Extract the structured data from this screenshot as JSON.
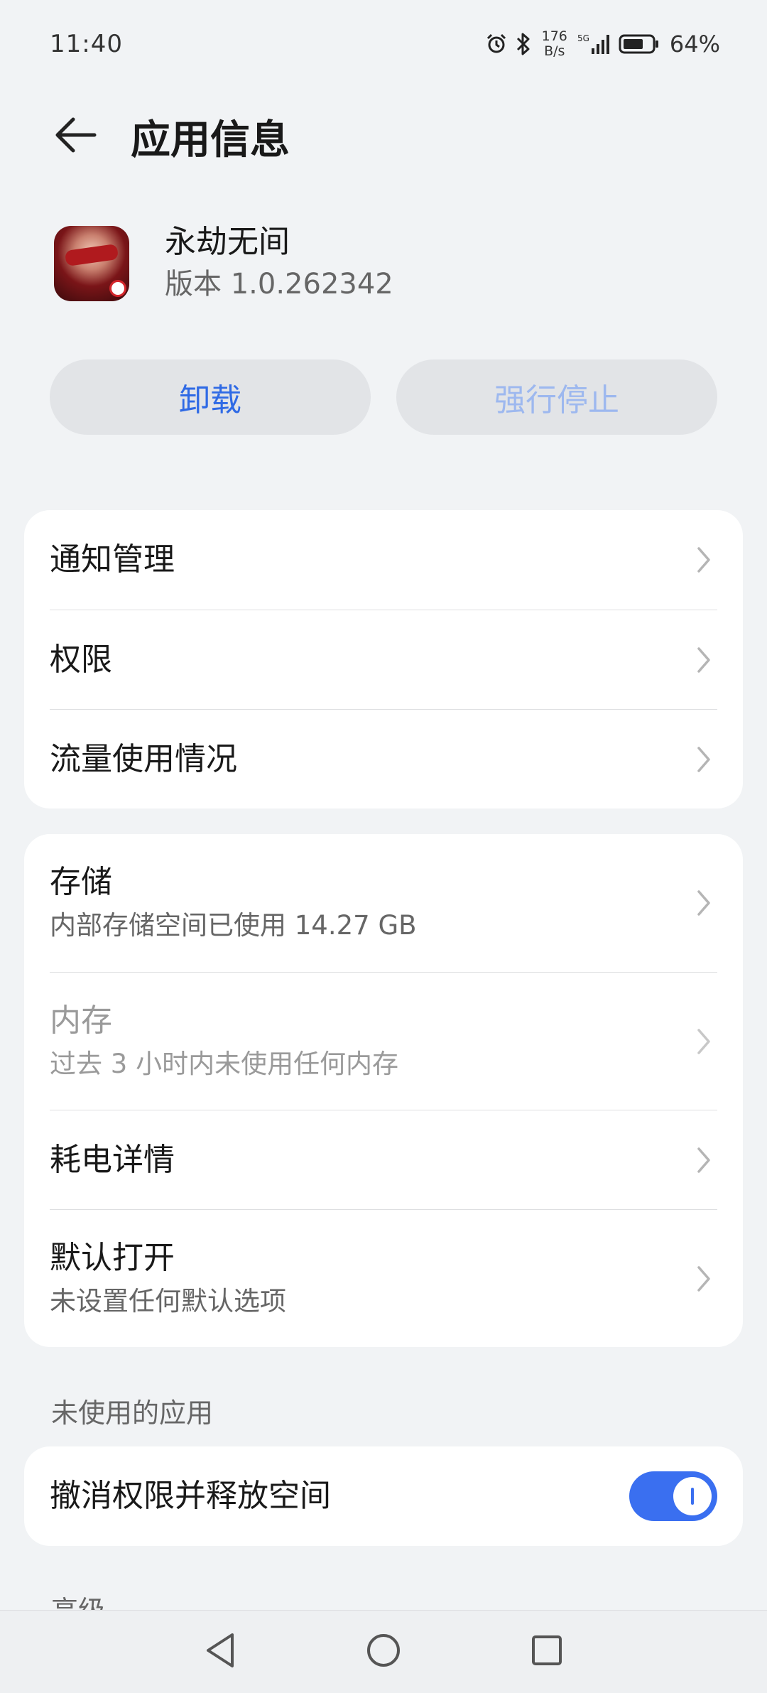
{
  "status_bar": {
    "time": "11:40",
    "net_speed_value": "176",
    "net_speed_unit": "B/s",
    "network_type": "5G",
    "battery_percent": "64%",
    "icons": [
      "alarm-icon",
      "bluetooth-icon",
      "signal-icon",
      "battery-icon"
    ]
  },
  "header": {
    "title": "应用信息",
    "back_icon": "arrow-left-icon"
  },
  "app": {
    "name": "永劫无间",
    "version": "版本 1.0.262342"
  },
  "actions": {
    "uninstall_label": "卸载",
    "force_stop_label": "强行停止"
  },
  "group1": {
    "items": [
      {
        "title": "通知管理"
      },
      {
        "title": "权限"
      },
      {
        "title": "流量使用情况"
      }
    ]
  },
  "group2": {
    "items": [
      {
        "title": "存储",
        "subtitle": "内部存储空间已使用 14.27 GB"
      },
      {
        "title": "内存",
        "subtitle": "过去 3 小时内未使用任何内存"
      },
      {
        "title": "耗电详情"
      },
      {
        "title": "默认打开",
        "subtitle": "未设置任何默认选项"
      }
    ]
  },
  "unused_apps": {
    "section_label": "未使用的应用",
    "toggle_label": "撤消权限并释放空间",
    "toggle_on": true
  },
  "advanced": {
    "section_label": "高级"
  },
  "nav_bar": {
    "icons": [
      "back-triangle-icon",
      "home-circle-icon",
      "recents-square-icon"
    ]
  },
  "colors": {
    "accent": "#3a6ff0",
    "button_text": "#2f6ae5",
    "background": "#f1f3f5"
  }
}
